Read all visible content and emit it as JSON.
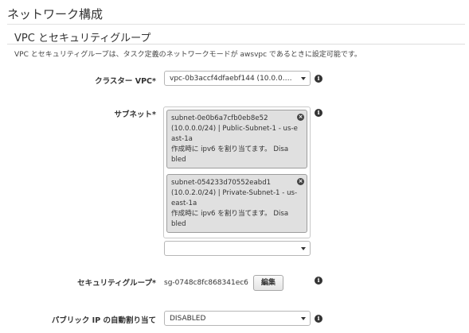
{
  "header": {
    "page_title": "ネットワーク構成"
  },
  "section": {
    "title": "VPC とセキュリティグループ",
    "description": "VPC とセキュリティグループは、タスク定義のネットワークモードが awsvpc であるときに設定可能です。"
  },
  "cluster_vpc": {
    "label": "クラスター VPC*",
    "value": "vpc-0b3accf4dfaebf144 (10.0.0.0/..."
  },
  "subnets": {
    "label": "サブネット*",
    "items": [
      {
        "lines": [
          "subnet-0e0b6a7cfb0eb8e52",
          "(10.0.0.0/24) | Public-Subnet-1 - us-e",
          "ast-1a",
          "作成時に ipv6 を割り当てます。 Disa",
          "bled"
        ]
      },
      {
        "lines": [
          "subnet-054233d70552eabd1",
          "(10.0.2.0/24) | Private-Subnet-1 - us-",
          "east-1a",
          "作成時に ipv6 を割り当てます。 Disa",
          "bled"
        ]
      }
    ],
    "add_select_value": ""
  },
  "security_group": {
    "label": "セキュリティグループ*",
    "value": "sg-0748c8fc868341ec6",
    "edit_label": "編集"
  },
  "public_ip": {
    "label": "パブリック IP の自動割り当て",
    "value": "DISABLED"
  },
  "icons": {
    "info": "i",
    "remove": "×"
  }
}
